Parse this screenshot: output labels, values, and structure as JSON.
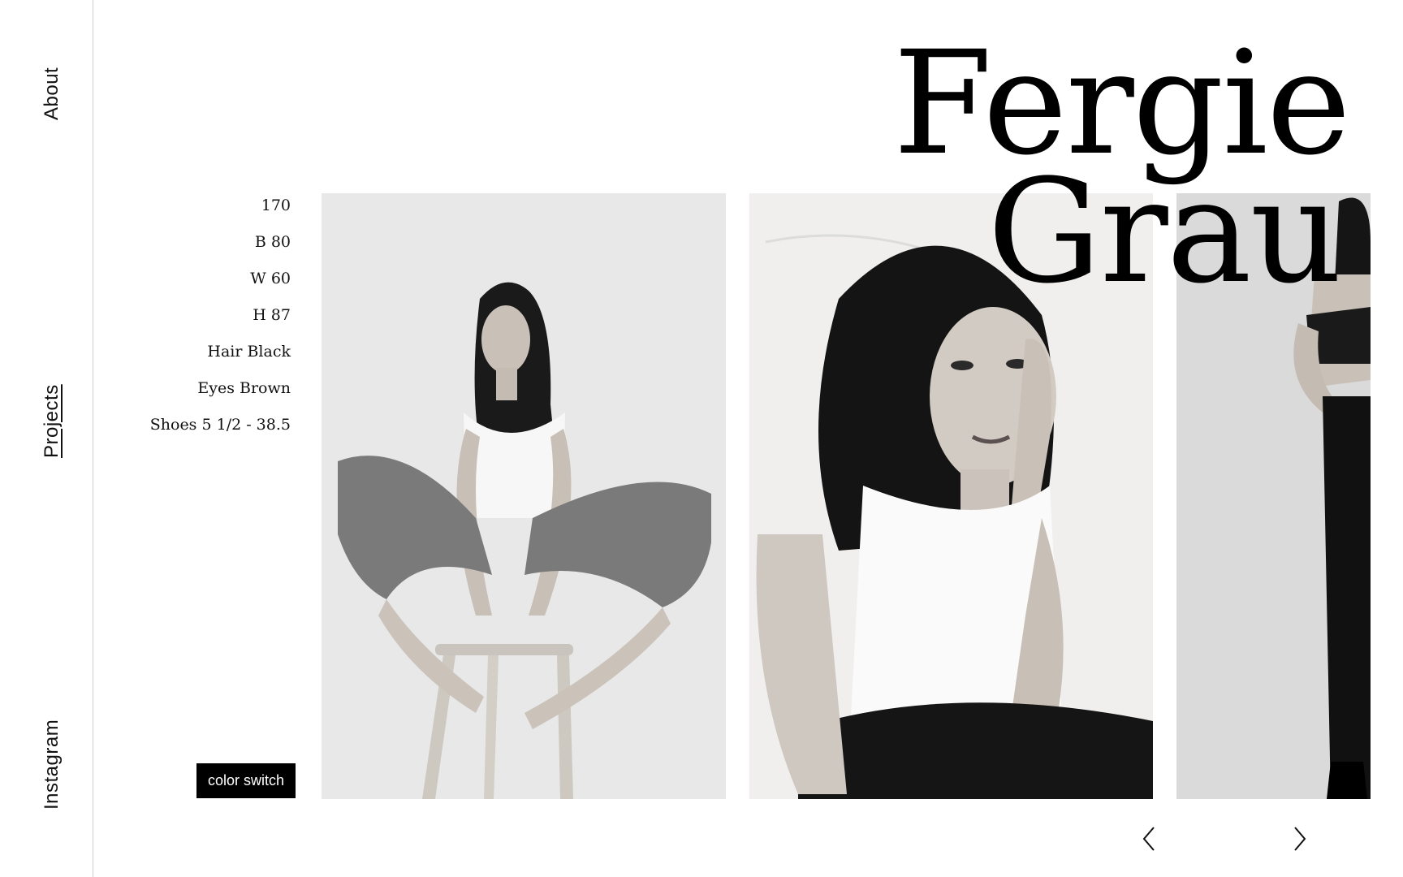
{
  "sidebar": {
    "about": "About",
    "projects": "Projects",
    "instagram": "Instagram"
  },
  "model": {
    "first_name": "Fergie",
    "last_name": "Grau"
  },
  "stats": [
    "170",
    "B 80",
    "W 60",
    "H 87",
    "Hair Black",
    "Eyes Brown",
    "Shoes 5 1/2 - 38.5"
  ],
  "color_switch_label": "color switch",
  "icons": {
    "prev": "chevron-left-icon",
    "next": "chevron-right-icon"
  },
  "colors": {
    "background": "#ffffff",
    "text": "#000000",
    "button_bg": "#000000",
    "button_text": "#ffffff"
  }
}
